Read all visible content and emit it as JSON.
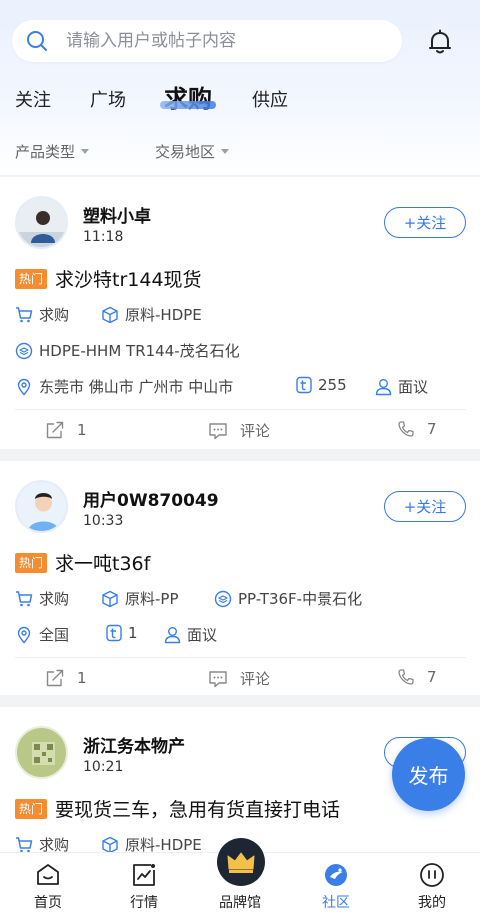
{
  "search": {
    "placeholder": "请输入用户或帖子内容"
  },
  "tabs": [
    "关注",
    "广场",
    "求购",
    "供应"
  ],
  "filters": [
    "产品类型",
    "交易地区"
  ],
  "posts": [
    {
      "user": "塑料小卓",
      "time": "11:18",
      "follow": "+关注",
      "tag": "热门",
      "title": "求沙特tr144现货",
      "type": "求购",
      "category": "原料-HDPE",
      "spec": "HDPE-HHM TR144-茂名石化",
      "region": "东莞市 佛山市 广州市 中山市",
      "quantity": "255",
      "price": "面议",
      "share": "1",
      "comment": "评论",
      "calls": "7"
    },
    {
      "user": "用户0W870049",
      "time": "10:33",
      "follow": "+关注",
      "tag": "热门",
      "title": "求一吨t36f",
      "type": "求购",
      "category": "原料-PP",
      "spec": "PP-T36F-中景石化",
      "region": "全国",
      "quantity": "1",
      "price": "面议",
      "share": "1",
      "comment": "评论",
      "calls": "7"
    },
    {
      "user": "浙江务本物产",
      "time": "10:21",
      "follow": "+关注",
      "tag": "热门",
      "title": "要现货三车，急用有货直接打电话",
      "type": "求购",
      "category": "原料-HDPE"
    }
  ],
  "fab": "发布",
  "nav": [
    "首页",
    "行情",
    "品牌馆",
    "社区",
    "我的"
  ],
  "colors": {
    "accent": "#3a7ee8",
    "hot": "#f58c2f"
  }
}
